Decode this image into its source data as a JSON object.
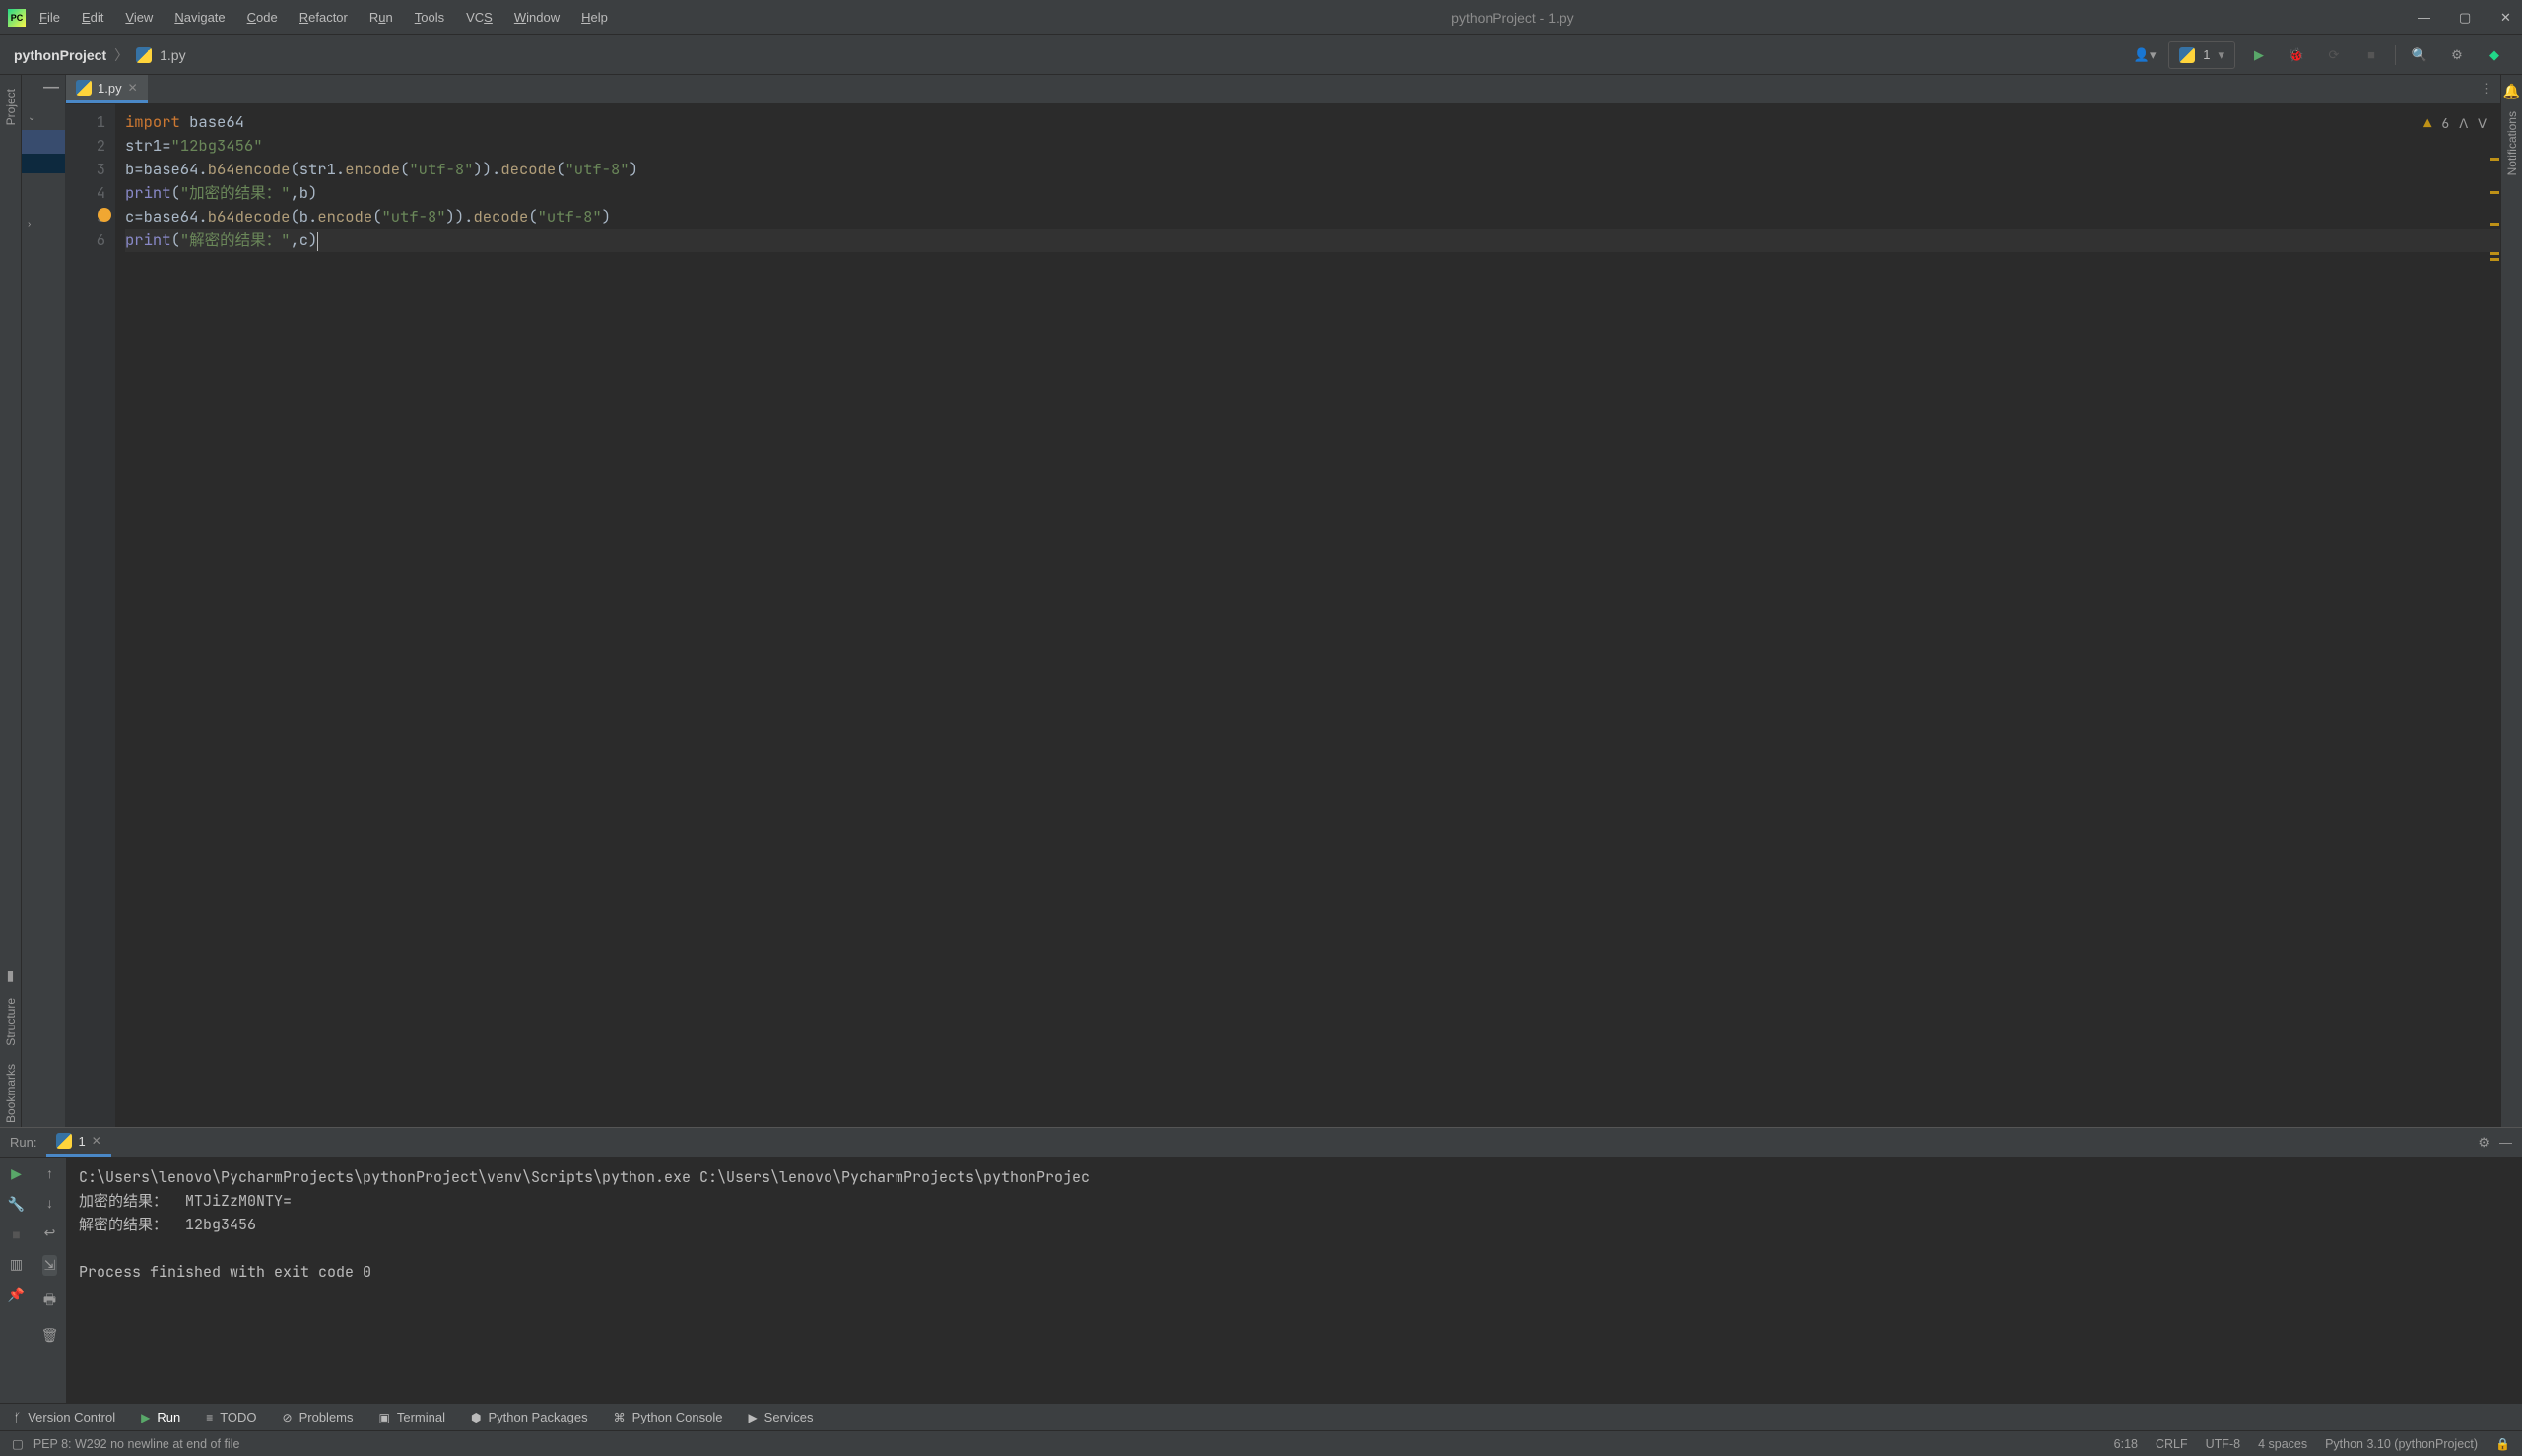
{
  "window": {
    "title": "pythonProject - 1.py"
  },
  "menu": {
    "file": "File",
    "edit": "Edit",
    "view": "View",
    "navigate": "Navigate",
    "code": "Code",
    "refactor": "Refactor",
    "run": "Run",
    "tools": "Tools",
    "vcs": "VCS",
    "window": "Window",
    "help": "Help"
  },
  "breadcrumb": {
    "project": "pythonProject",
    "file": "1.py"
  },
  "run_config": {
    "name": "1"
  },
  "side": {
    "project": "Project",
    "structure": "Structure",
    "bookmarks": "Bookmarks",
    "notifications": "Notifications"
  },
  "tabs": [
    {
      "label": "1.py"
    }
  ],
  "problems_indicator": {
    "count": "6"
  },
  "code_lines": [
    {
      "n": "1",
      "tokens": [
        [
          "kw",
          "import"
        ],
        [
          "",
          " base64"
        ]
      ]
    },
    {
      "n": "2",
      "tokens": [
        [
          "",
          "str1="
        ],
        [
          "str",
          "\"12bg3456\""
        ]
      ]
    },
    {
      "n": "3",
      "tokens": [
        [
          "",
          "b=base64."
        ],
        [
          "fn",
          "b64encode"
        ],
        [
          "",
          "(str1."
        ],
        [
          "fn",
          "encode"
        ],
        [
          "",
          "("
        ],
        [
          "str",
          "\"utf-8\""
        ],
        [
          "",
          "))."
        ],
        [
          "fn",
          "decode"
        ],
        [
          "",
          "("
        ],
        [
          "str",
          "\"utf-8\""
        ],
        [
          "",
          ")"
        ]
      ]
    },
    {
      "n": "4",
      "tokens": [
        [
          "bi",
          "print"
        ],
        [
          "",
          "("
        ],
        [
          "str",
          "\"加密的结果：\""
        ],
        [
          "",
          ",b)"
        ]
      ]
    },
    {
      "n": "5",
      "tokens": [
        [
          "",
          "c=base64."
        ],
        [
          "fn",
          "b64decode"
        ],
        [
          "",
          "(b."
        ],
        [
          "fn",
          "encode"
        ],
        [
          "",
          "("
        ],
        [
          "str",
          "\"utf-8\""
        ],
        [
          "",
          "))."
        ],
        [
          "fn",
          "decode"
        ],
        [
          "",
          "("
        ],
        [
          "str",
          "\"utf-8\""
        ],
        [
          "",
          ")"
        ]
      ]
    },
    {
      "n": "6",
      "tokens": [
        [
          "bi",
          "print"
        ],
        [
          "",
          "("
        ],
        [
          "str",
          "\"解密的结果：\""
        ],
        [
          "",
          ",c)"
        ]
      ]
    }
  ],
  "run_panel": {
    "label": "Run:",
    "tab": "1",
    "output": [
      "C:\\Users\\lenovo\\PycharmProjects\\pythonProject\\venv\\Scripts\\python.exe C:\\Users\\lenovo\\PycharmProjects\\pythonProjec",
      "加密的结果：  MTJiZzM0NTY=",
      "解密的结果：  12bg3456",
      "",
      "Process finished with exit code 0"
    ]
  },
  "tool_windows": {
    "version_control": "Version Control",
    "run": "Run",
    "todo": "TODO",
    "problems": "Problems",
    "terminal": "Terminal",
    "python_packages": "Python Packages",
    "python_console": "Python Console",
    "services": "Services"
  },
  "status": {
    "message": "PEP 8: W292 no newline at end of file",
    "pos": "6:18",
    "line_sep": "CRLF",
    "encoding": "UTF-8",
    "indent": "4 spaces",
    "interpreter": "Python 3.10 (pythonProject)"
  }
}
